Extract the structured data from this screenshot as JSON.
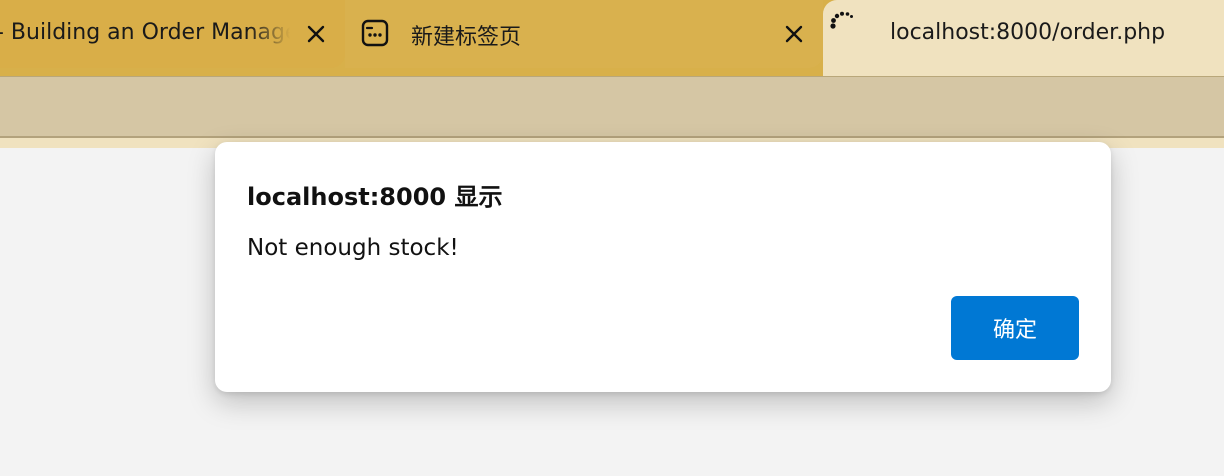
{
  "browser": {
    "tabs": [
      {
        "title": "- Building an Order Manage",
        "state": "inactive"
      },
      {
        "title": "新建标签页",
        "state": "inactive",
        "icon": "new-tab-page-icon"
      },
      {
        "title": "localhost:8000/order.php",
        "state": "active-loading",
        "icon": "loading-spinner-icon"
      }
    ]
  },
  "dialog": {
    "title": "localhost:8000 显示",
    "message": "Not enough stock!",
    "ok_label": "确定"
  },
  "colors": {
    "tabstrip": "#d8b04a",
    "active_tab": "#f0e2bf",
    "toolbar": "#d5c6a4",
    "page_background": "#f3f3f3",
    "dialog_background": "#ffffff",
    "primary_button": "#0078d4"
  }
}
